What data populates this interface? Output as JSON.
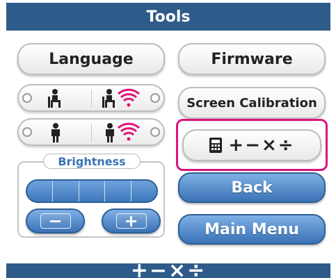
{
  "header": {
    "title": "Tools"
  },
  "buttons": {
    "language": "Language",
    "firmware": "Firmware",
    "screen_calibration": "Screen Calibration",
    "calculator_ops": "+−×÷",
    "back": "Back",
    "main_menu": "Main Menu",
    "brightness_minus": "−",
    "brightness_plus": "+"
  },
  "brightness": {
    "label": "Brightness"
  },
  "footer": {
    "title": "+−×÷"
  },
  "colors": {
    "header_bg": "#2e5b8a",
    "accent_blue": "#3d77bd",
    "highlight_frame": "#d8147f",
    "wifi_icon": "#e3127a"
  },
  "icons": {
    "seated_user": "seated-person-icon",
    "seated_wifi": "seated-person-wifi-icon",
    "standing_user": "standing-person-icon",
    "standing_wifi": "standing-person-wifi-icon",
    "calculator": "calculator-icon"
  }
}
